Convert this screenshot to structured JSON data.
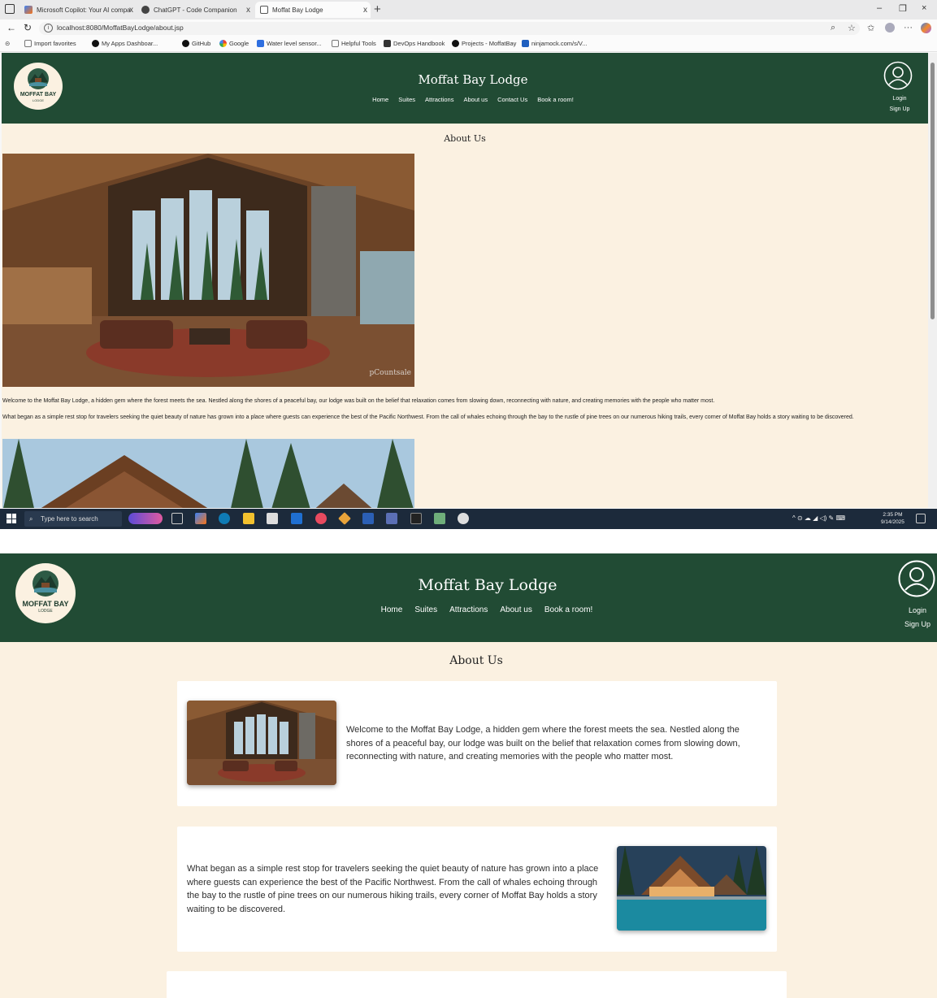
{
  "browser": {
    "tabs": [
      {
        "title": "Microsoft Copilot: Your AI compa",
        "close": "x"
      },
      {
        "title": "ChatGPT - Code Companion",
        "close": "x"
      },
      {
        "title": "Moffat Bay Lodge",
        "close": "x"
      }
    ],
    "new_tab": "+",
    "window_controls": {
      "minimize": "–",
      "restore": "❐",
      "close": "×"
    },
    "url": "localhost:8080/MoffatBayLodge/about.jsp",
    "bookmarks": [
      "Import favorites",
      "My Apps Dashboar...",
      "GitHub",
      "Google",
      "Water level sensor...",
      "Helpful Tools",
      "DevOps Handbook",
      "Projects - MoffatBay",
      "ninjamock.com/s/V..."
    ]
  },
  "site": {
    "title": "Moffat Bay Lodge",
    "logo_text": "MOFFAT BAY",
    "logo_sub": "LODGE",
    "nav_old": [
      "Home",
      "Suites",
      "Attractions",
      "About us",
      "Contact Us",
      "Book a room!"
    ],
    "nav_new": [
      "Home",
      "Suites",
      "Attractions",
      "About us",
      "Book a room!"
    ],
    "login": "Login",
    "signup": "Sign Up",
    "heading": "About Us",
    "watermark": "pCountsale",
    "para1": "Welcome to the Moffat Bay Lodge, a hidden gem where the forest meets the sea. Nestled along the shores of a peaceful bay, our lodge was built on the belief that relaxation comes from slowing down, reconnecting with nature, and creating memories with the people who matter most.",
    "para2": "What began as a simple rest stop for travelers seeking the quiet beauty of nature has grown into a place where guests can experience the best of the Pacific Northwest. From the call of whales echoing through the bay to the rustle of pine trees on our numerous hiking trails, every corner of Moffat Bay holds a story waiting to be discovered."
  },
  "taskbar": {
    "search_placeholder": "Type here to search",
    "time": "2:35 PM",
    "date": "9/14/2025"
  },
  "colors": {
    "header_green": "#214b34",
    "page_cream": "#fbf1e1",
    "card_white": "#ffffff"
  }
}
